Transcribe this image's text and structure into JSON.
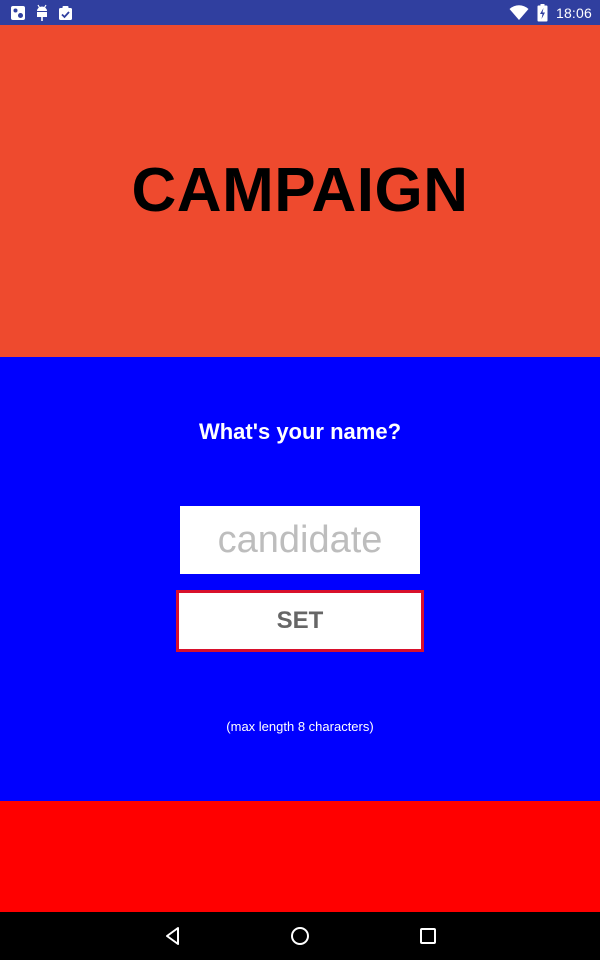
{
  "status_bar": {
    "time": "18:06",
    "left_icons": [
      "photo-app-icon",
      "android-debug-icon",
      "clipboard-check-icon"
    ],
    "right_icons": [
      "wifi-icon",
      "battery-charging-icon"
    ],
    "background": "#303F9F"
  },
  "header": {
    "title": "CAMPAIGN",
    "background": "#EE4A2E"
  },
  "form": {
    "question": "What's your name?",
    "name_input": {
      "value": "",
      "placeholder": "candidate"
    },
    "set_button_label": "SET",
    "hint": "(max length 8 characters)",
    "background": "#0000FF",
    "button_border_color": "#D8102B"
  },
  "footer": {
    "background": "#FF0000"
  },
  "nav_bar": {
    "buttons": [
      "back-icon",
      "home-icon",
      "recents-icon"
    ]
  }
}
